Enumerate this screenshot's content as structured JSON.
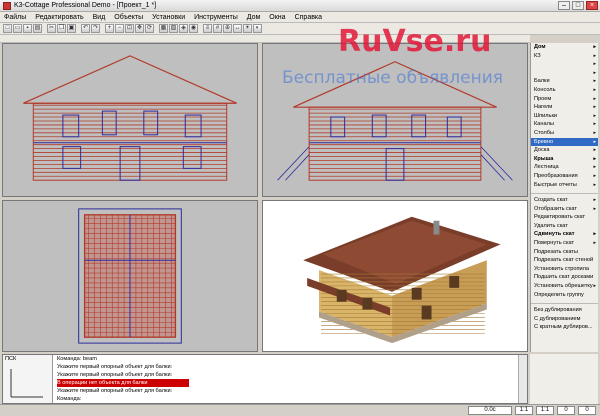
{
  "window": {
    "title": "K3-Cottage Professional Demo - [Проект_1 *]"
  },
  "menu": [
    "Файлы",
    "Редактировать",
    "Вид",
    "Объекты",
    "Установки",
    "Инструменты",
    "Дом",
    "Окна",
    "Справка"
  ],
  "watermark": {
    "brand": "RuVse.ru",
    "tagline": "Бесплатные объявления"
  },
  "right_panel": {
    "items": [
      {
        "label": "Дом",
        "arrow": true,
        "bold": true
      },
      {
        "label": "КЗ",
        "arrow": true
      },
      {
        "label": "",
        "arrow": true
      },
      {
        "label": "",
        "arrow": true
      },
      {
        "label": "Балки",
        "arrow": true
      },
      {
        "label": "Консоль",
        "arrow": true
      },
      {
        "label": "Проем",
        "arrow": true
      },
      {
        "label": "Нагели",
        "arrow": true
      },
      {
        "label": "Шпильки",
        "arrow": true
      },
      {
        "label": "Каналы",
        "arrow": true
      },
      {
        "label": "Столбы",
        "arrow": true
      },
      {
        "label": "Бревно",
        "arrow": true,
        "selected": true
      },
      {
        "label": "Доска",
        "arrow": true
      },
      {
        "label": "Крыша",
        "arrow": true,
        "bold": true
      },
      {
        "label": "Лестница",
        "arrow": true
      },
      {
        "label": "Преобразования",
        "arrow": true
      },
      {
        "label": "Быстрые отчеты",
        "arrow": true
      }
    ],
    "roof_items": [
      {
        "label": "Создать скат",
        "arrow": true
      },
      {
        "label": "Отобразить скат",
        "arrow": true
      },
      {
        "label": "Редактировать скат",
        "arrow": false
      },
      {
        "label": "Удалить скат",
        "arrow": false
      },
      {
        "label": "Сдвинуть скат",
        "arrow": true,
        "bold": true
      },
      {
        "label": "Повернуть скат",
        "arrow": true
      },
      {
        "label": "Подрезать скаты",
        "arrow": false
      },
      {
        "label": "Подрезать скат стеной",
        "arrow": false
      },
      {
        "label": "Установить стропила",
        "arrow": false
      },
      {
        "label": "Подшить скат досками",
        "arrow": false
      },
      {
        "label": "Установить обрешетку",
        "arrow": true
      },
      {
        "label": "Определить группу",
        "arrow": false
      }
    ],
    "dup_items": [
      {
        "label": "Без дублирования"
      },
      {
        "label": "С дублированием"
      },
      {
        "label": "С кратным дублиров..."
      }
    ]
  },
  "command": {
    "left_label": "ПСК",
    "lines": [
      {
        "text": "Команда: beam",
        "error": false
      },
      {
        "text": "Укажите первый опорный объект для балки:",
        "error": false
      },
      {
        "text": "Укажите первый опорный объект для балки:",
        "error": false
      },
      {
        "text": "В операции нет объекта для балки",
        "error": true
      },
      {
        "text": "Укажите первый опорный объект для балки:",
        "error": false
      },
      {
        "text": "Команда:",
        "error": false
      }
    ]
  },
  "status": {
    "zoom": "0.0с",
    "v1": "1:1",
    "v2": "1:1",
    "v3": "0",
    "v4": "0"
  },
  "colors": {
    "wall": "#b23a2a",
    "frame": "#2a2aa0",
    "log": "#d9b56a",
    "roof": "#7a3d2a",
    "sky": "#6a8fd0"
  }
}
